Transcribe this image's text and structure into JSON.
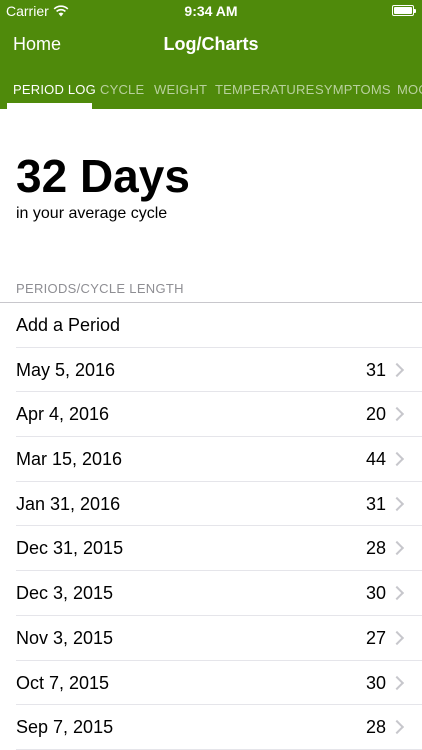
{
  "status_bar": {
    "carrier": "Carrier",
    "time": "9:34 AM"
  },
  "nav": {
    "back_label": "Home",
    "title": "Log/Charts"
  },
  "tabs": [
    {
      "label": "PERIOD LOG",
      "active": true
    },
    {
      "label": "CYCLE",
      "active": false
    },
    {
      "label": "WEIGHT",
      "active": false
    },
    {
      "label": "TEMPERATURE",
      "active": false
    },
    {
      "label": "SYMPTOMS",
      "active": false
    },
    {
      "label": "MOO",
      "active": false
    }
  ],
  "summary": {
    "value": "32 Days",
    "subtitle": "in your average cycle"
  },
  "section": {
    "header": "PERIODS/CYCLE LENGTH"
  },
  "add_period": {
    "label": "Add a Period"
  },
  "periods": [
    {
      "date": "May 5, 2016",
      "length": "31"
    },
    {
      "date": "Apr 4, 2016",
      "length": "20"
    },
    {
      "date": "Mar 15, 2016",
      "length": "44"
    },
    {
      "date": "Jan 31, 2016",
      "length": "31"
    },
    {
      "date": "Dec 31, 2015",
      "length": "28"
    },
    {
      "date": "Dec 3, 2015",
      "length": "30"
    },
    {
      "date": "Nov 3, 2015",
      "length": "27"
    },
    {
      "date": "Oct 7, 2015",
      "length": "30"
    },
    {
      "date": "Sep 7, 2015",
      "length": "28"
    }
  ],
  "colors": {
    "header_green": "#4f8a0b",
    "chevron": "#c7c7cc",
    "section_header": "#8e8e93"
  }
}
